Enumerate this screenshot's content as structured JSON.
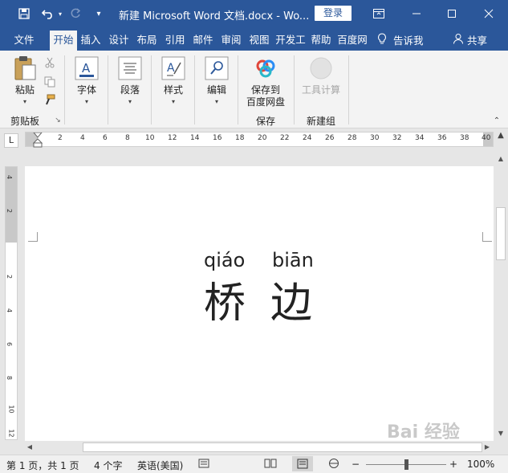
{
  "window": {
    "title": "新建 Microsoft Word 文档.docx  -  Wo...",
    "login_label": "登录"
  },
  "ribbon_tabs": [
    {
      "label": "文件"
    },
    {
      "label": "开始"
    },
    {
      "label": "插入"
    },
    {
      "label": "设计"
    },
    {
      "label": "布局"
    },
    {
      "label": "引用"
    },
    {
      "label": "邮件"
    },
    {
      "label": "审阅"
    },
    {
      "label": "视图"
    },
    {
      "label": "开发工"
    },
    {
      "label": "帮助"
    },
    {
      "label": "百度网"
    }
  ],
  "tell_me": "告诉我",
  "share": "共享",
  "ribbon": {
    "paste": "粘贴",
    "clipboard_group": "剪贴板",
    "font": "字体",
    "paragraph": "段落",
    "styles": "样式",
    "editing": "编辑",
    "save_to_line1": "保存到",
    "save_to_line2": "百度网盘",
    "save_group": "保存",
    "tool_calc": "工具计算",
    "new_group": "新建组"
  },
  "ruler": {
    "tab_selector": "L",
    "h_numbers": [
      "2",
      "4",
      "6",
      "8",
      "10",
      "12",
      "14",
      "16",
      "18",
      "20",
      "22",
      "24",
      "26",
      "28",
      "30",
      "32",
      "34",
      "36",
      "38",
      "40"
    ],
    "v_numbers": [
      "4",
      "2",
      "",
      "2",
      "4",
      "6",
      "8",
      "10",
      "12"
    ]
  },
  "document": {
    "pinyin_1": "qiáo",
    "pinyin_2": "biān",
    "hanzi_1": "桥",
    "hanzi_2": "边"
  },
  "statusbar": {
    "page_info": "第 1 页，共 1 页",
    "word_count": "4 个字",
    "language": "英语(美国)",
    "zoom_minus": "−",
    "zoom_plus": "+",
    "zoom": "100%",
    "zoom_fraction": 0.5
  },
  "watermark": "Bai 经验",
  "colors": {
    "accent": "#2b579a",
    "ribbon_bg": "#f3f3f3"
  }
}
